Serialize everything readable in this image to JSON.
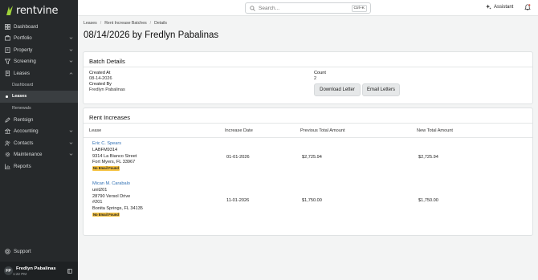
{
  "brand": {
    "name": "rentvine"
  },
  "sidebar": {
    "items": [
      {
        "label": "Dashboard"
      },
      {
        "label": "Portfolio"
      },
      {
        "label": "Property"
      },
      {
        "label": "Screening"
      },
      {
        "label": "Leases"
      }
    ],
    "leases_sub": [
      {
        "label": "Dashboard"
      },
      {
        "label": "Leases"
      },
      {
        "label": "Renewals"
      }
    ],
    "items2": [
      {
        "label": "Rentsign"
      },
      {
        "label": "Accounting"
      },
      {
        "label": "Contacts"
      },
      {
        "label": "Maintenance"
      },
      {
        "label": "Reports"
      }
    ],
    "support": "Support",
    "user": {
      "initials": "FP",
      "name": "Fredlyn Pabalinas",
      "time": "1:22 PM"
    }
  },
  "topbar": {
    "search_placeholder": "Search...",
    "shortcut": "Ctrl+K",
    "assistant": "Assistant"
  },
  "breadcrumb": [
    "Leases",
    "Rent Increase Batches",
    "Details"
  ],
  "page_title": "08/14/2026 by Fredlyn Pabalinas",
  "batch": {
    "heading": "Batch Details",
    "created_at_label": "Created At",
    "created_at": "08-14-2026",
    "created_by_label": "Created By",
    "created_by": "Fredlyn Pabalinas",
    "count_label": "Count",
    "count": "2",
    "download_label": "Download Letter",
    "email_label": "Email Letters"
  },
  "increases": {
    "heading": "Rent Increases",
    "columns": [
      "Lease",
      "Increase Date",
      "Previous Total Amount",
      "New Total Amount"
    ],
    "rows": [
      {
        "tenant": "Eric C. Spears",
        "lines": [
          "LABFM9314",
          "9314 La Bianco Street",
          "Fort Myers, FL 33967"
        ],
        "badge": "No Email Found",
        "date": "01-01-2026",
        "prev": "$2,725.94",
        "new": "$2,725.94"
      },
      {
        "tenant": "Mican M. Carabalo",
        "lines": [
          "unit201",
          "28790 Versol Drive",
          "#201",
          "Bonita Springs, FL 34135"
        ],
        "badge": "No Email Found",
        "date": "11-01-2026",
        "prev": "$1,750.00",
        "new": "$1,750.00"
      }
    ]
  }
}
